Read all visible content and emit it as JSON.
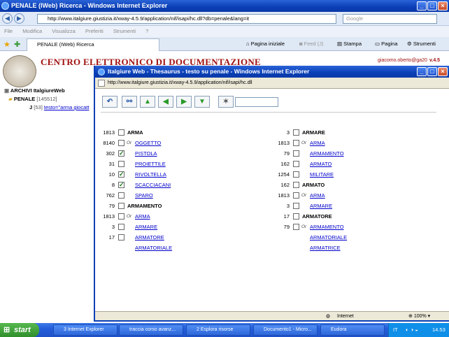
{
  "outer_window": {
    "title": "PENALE (IWeb) Ricerca - Windows Internet Explorer",
    "url": "http://www.italgiure.giustizia.it/xway-4.5.9/application/nif/isapi/hc.dll?db=penale&lang=it",
    "search_placeholder": "Google",
    "menu": [
      "File",
      "Modifica",
      "Visualizza",
      "Preferiti",
      "Strumenti",
      "?"
    ],
    "tab_label": "PENALE (IWeb) Ricerca",
    "toolbar": {
      "home": "Pagina iniziale",
      "feed": "Feed (J)",
      "print": "Stampa",
      "page": "Pagina",
      "tools": "Strumenti"
    }
  },
  "page": {
    "title": "CENTRO ELETTRONICO DI DOCUMENTAZIONE",
    "user": "giacomo.oberto@ga20",
    "version": "v.4.5",
    "tree": {
      "root": "ARCHIVI ItalgiureWeb",
      "db": "PENALE",
      "db_count": "[145512]",
      "query_prefix": "J",
      "query_count": "[53]",
      "query_text": "testo=\"arma giocatt"
    }
  },
  "popup": {
    "title": "Italgiure Web - Thesaurus - testo su penale - Windows Internet Explorer",
    "url": "http://www.italgiure.giustizia.it/xway-4.5.9/application/nif/isapi/hc.dll",
    "toolbar_icons": [
      "undo-icon",
      "binoculars-icon",
      "up-icon",
      "left-icon",
      "right-icon",
      "down-icon",
      "wand-icon"
    ],
    "left_column": [
      {
        "count": "1813",
        "check": true,
        "checked": false,
        "or": false,
        "term": "ARMA",
        "head": true
      },
      {
        "count": "8140",
        "check": true,
        "checked": false,
        "or": true,
        "term": "OGGETTO",
        "head": false
      },
      {
        "count": "302",
        "check": true,
        "checked": true,
        "or": false,
        "term": "PISTOLA",
        "head": false
      },
      {
        "count": "31",
        "check": true,
        "checked": false,
        "or": false,
        "term": "PROIETTILE",
        "head": false
      },
      {
        "count": "10",
        "check": true,
        "checked": true,
        "or": false,
        "term": "RIVOLTELLA",
        "head": false
      },
      {
        "count": "8",
        "check": true,
        "checked": true,
        "or": false,
        "term": "SCACCIACANI",
        "head": false
      },
      {
        "count": "762",
        "check": true,
        "checked": false,
        "or": false,
        "term": "SPARO",
        "head": false
      },
      {
        "count": "79",
        "check": true,
        "checked": false,
        "or": false,
        "term": "ARMAMENTO",
        "head": true
      },
      {
        "count": "1813",
        "check": true,
        "checked": false,
        "or": true,
        "term": "ARMA",
        "head": false
      },
      {
        "count": "3",
        "check": true,
        "checked": false,
        "or": false,
        "term": "ARMARE",
        "head": false
      },
      {
        "count": "17",
        "check": true,
        "checked": false,
        "or": false,
        "term": "ARMATORE",
        "head": false
      },
      {
        "count": "",
        "check": false,
        "checked": false,
        "or": false,
        "term": "ARMATORIALE",
        "head": false
      }
    ],
    "right_column": [
      {
        "count": "3",
        "check": true,
        "checked": false,
        "or": false,
        "term": "ARMARE",
        "head": true
      },
      {
        "count": "1813",
        "check": true,
        "checked": false,
        "or": true,
        "term": "ARMA",
        "head": false
      },
      {
        "count": "79",
        "check": true,
        "checked": false,
        "or": false,
        "term": "ARMAMENTO",
        "head": false
      },
      {
        "count": "162",
        "check": true,
        "checked": false,
        "or": false,
        "term": "ARMATO",
        "head": false
      },
      {
        "count": "1254",
        "check": true,
        "checked": false,
        "or": false,
        "term": "MILITARE",
        "head": false
      },
      {
        "count": "162",
        "check": true,
        "checked": false,
        "or": false,
        "term": "ARMATO",
        "head": true
      },
      {
        "count": "1813",
        "check": true,
        "checked": false,
        "or": true,
        "term": "ARMA",
        "head": false
      },
      {
        "count": "3",
        "check": true,
        "checked": false,
        "or": false,
        "term": "ARMARE",
        "head": false
      },
      {
        "count": "17",
        "check": true,
        "checked": false,
        "or": false,
        "term": "ARMATORE",
        "head": true
      },
      {
        "count": "79",
        "check": true,
        "checked": false,
        "or": true,
        "term": "ARMAMENTO",
        "head": false
      },
      {
        "count": "",
        "check": false,
        "checked": false,
        "or": false,
        "term": "ARMATORIALE",
        "head": false
      },
      {
        "count": "",
        "check": false,
        "checked": false,
        "or": false,
        "term": "ARMATRICE",
        "head": false
      }
    ],
    "or_label": "Or",
    "status_zone": "Internet",
    "zoom": "100%"
  },
  "taskbar": {
    "start": "start",
    "tasks": [
      "3 Internet Explorer",
      "traccia corso avanz...",
      "2 Esplora risorse",
      "Documento1 - Micro...",
      "Eudora"
    ],
    "lang": "IT",
    "clock": "14.53"
  },
  "colors": {
    "title_blue": "#0a3fb6",
    "heading_red": "#a01010",
    "link_blue": "#0000cc"
  }
}
